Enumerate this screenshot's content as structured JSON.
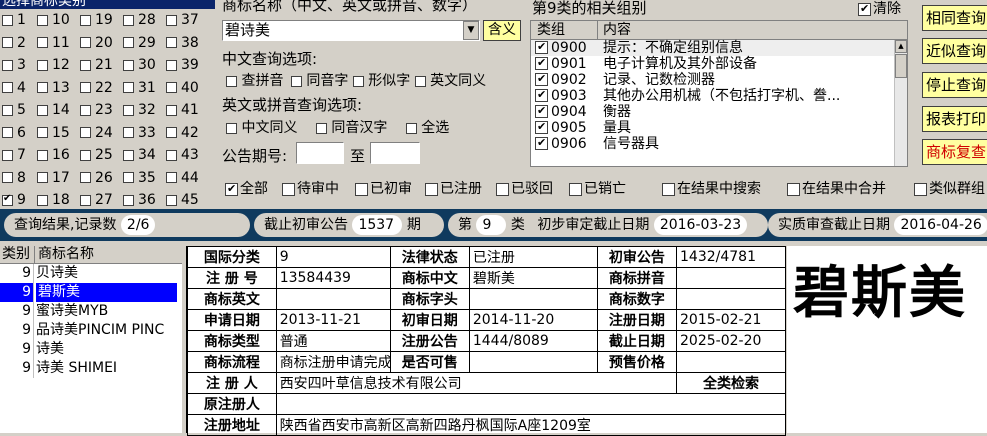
{
  "category_panel": {
    "title": "选择商标类别",
    "columns": [
      [
        {
          "n": "1",
          "on": false
        },
        {
          "n": "2",
          "on": false
        },
        {
          "n": "3",
          "on": false
        },
        {
          "n": "4",
          "on": false
        },
        {
          "n": "5",
          "on": false
        },
        {
          "n": "6",
          "on": false
        },
        {
          "n": "7",
          "on": false
        },
        {
          "n": "8",
          "on": false
        },
        {
          "n": "9",
          "on": true
        }
      ],
      [
        {
          "n": "10",
          "on": false
        },
        {
          "n": "11",
          "on": false
        },
        {
          "n": "12",
          "on": false
        },
        {
          "n": "13",
          "on": false
        },
        {
          "n": "14",
          "on": false
        },
        {
          "n": "15",
          "on": false
        },
        {
          "n": "16",
          "on": false
        },
        {
          "n": "17",
          "on": false
        },
        {
          "n": "18",
          "on": false
        }
      ],
      [
        {
          "n": "19",
          "on": false
        },
        {
          "n": "20",
          "on": false
        },
        {
          "n": "21",
          "on": false
        },
        {
          "n": "22",
          "on": false
        },
        {
          "n": "23",
          "on": false
        },
        {
          "n": "24",
          "on": false
        },
        {
          "n": "25",
          "on": false
        },
        {
          "n": "26",
          "on": false
        },
        {
          "n": "27",
          "on": false
        }
      ],
      [
        {
          "n": "28",
          "on": false
        },
        {
          "n": "29",
          "on": false
        },
        {
          "n": "30",
          "on": false
        },
        {
          "n": "31",
          "on": false
        },
        {
          "n": "32",
          "on": false
        },
        {
          "n": "33",
          "on": false
        },
        {
          "n": "34",
          "on": false
        },
        {
          "n": "35",
          "on": false
        },
        {
          "n": "36",
          "on": false
        }
      ],
      [
        {
          "n": "37",
          "on": false
        },
        {
          "n": "38",
          "on": false
        },
        {
          "n": "39",
          "on": false
        },
        {
          "n": "40",
          "on": false
        },
        {
          "n": "41",
          "on": false
        },
        {
          "n": "42",
          "on": false
        },
        {
          "n": "43",
          "on": false
        },
        {
          "n": "44",
          "on": false
        },
        {
          "n": "45",
          "on": false
        }
      ]
    ]
  },
  "search": {
    "label": "商标名称（中文、英文或拼音、数字）",
    "value": "碧诗美",
    "meaning_button": "含义",
    "cn_options_label": "中文查询选项:",
    "cn_options": [
      "查拼音",
      "同音字",
      "形似字",
      "英文同义"
    ],
    "en_options_label": "英文或拼音查询选项:",
    "en_options": [
      "中文同义",
      "同音汉字",
      "全选"
    ],
    "gazette_label": "公告期号:",
    "gazette_to": "至"
  },
  "groups": {
    "title": "第9类的相关组别",
    "clear_label": "清除",
    "col_group": "类组",
    "col_content": "内容",
    "rows": [
      {
        "code": "0900",
        "text": "提示：不确定组别信息"
      },
      {
        "code": "0901",
        "text": "电子计算机及其外部设备"
      },
      {
        "code": "0902",
        "text": "记录、记数检测器"
      },
      {
        "code": "0903",
        "text": "其他办公用机械（不包括打字机、誊..."
      },
      {
        "code": "0904",
        "text": "衡器"
      },
      {
        "code": "0905",
        "text": "量具"
      },
      {
        "code": "0906",
        "text": "信号器具"
      }
    ]
  },
  "buttons": [
    "相同查询",
    "近似查询",
    "停止查询",
    "报表打印",
    "商标复查"
  ],
  "filters": [
    "全部",
    "待审中",
    "已初审",
    "已注册",
    "已驳回",
    "已销亡",
    "在结果中搜索",
    "在结果中合并",
    "类似群组"
  ],
  "status": {
    "result_label": "查询结果,记录数",
    "result_value": "2/6",
    "cutoff_label": "截止初审公告",
    "cutoff_value": "1537",
    "cutoff_unit": "期",
    "class_prefix": "第",
    "class_value": "9",
    "class_suffix": "类",
    "prelim_label": "初步审定截止日期",
    "prelim_value": "2016-03-23",
    "substantive_label": "实质审查截止日期",
    "substantive_value": "2016-04-26"
  },
  "results": {
    "col_class": "类别",
    "col_name": "商标名称",
    "rows": [
      {
        "cls": "9",
        "name": "贝诗美"
      },
      {
        "cls": "9",
        "name": "碧斯美"
      },
      {
        "cls": "9",
        "name": "蜜诗美MYB"
      },
      {
        "cls": "9",
        "name": "品诗美PINCIM PINC"
      },
      {
        "cls": "9",
        "name": "诗美"
      },
      {
        "cls": "9",
        "name": "诗美 SHIMEI"
      }
    ]
  },
  "detail": {
    "intl_class_l": "国际分类",
    "intl_class": "9",
    "legal_l": "法律状态",
    "legal": "已注册",
    "first_pub_l": "初审公告",
    "first_pub": "1432/4781",
    "reg_no_l": "注 册 号",
    "reg_no": "13584439",
    "cn_name_l": "商标中文",
    "cn_name": "碧斯美",
    "pinyin_l": "商标拼音",
    "pinyin": "",
    "en_name_l": "商标英文",
    "en_name": "",
    "initials_l": "商标字头",
    "initials": "",
    "digits_l": "商标数字",
    "digits": "",
    "apply_l": "申请日期",
    "apply": "2013-11-21",
    "first_date_l": "初审日期",
    "first_date": "2014-11-20",
    "reg_date_l": "注册日期",
    "reg_date": "2015-02-21",
    "type_l": "商标类型",
    "type": "普通",
    "reg_pub_l": "注册公告",
    "reg_pub": "1444/8089",
    "expire_l": "截止日期",
    "expire": "2025-02-20",
    "flow_l": "商标流程",
    "flow": "商标注册申请完成",
    "shared_l": "是否可售",
    "shared": "",
    "price_l": "预售价格",
    "price": "",
    "registrant_l": "注 册 人",
    "registrant": "西安四叶草信息技术有限公司",
    "full_search": "全类检索",
    "orig_l": "原注册人",
    "orig": "",
    "addr_l": "注册地址",
    "addr": "陕西省西安市高新区高新四路丹枫国际A座1209室"
  },
  "preview_text": "碧斯美"
}
